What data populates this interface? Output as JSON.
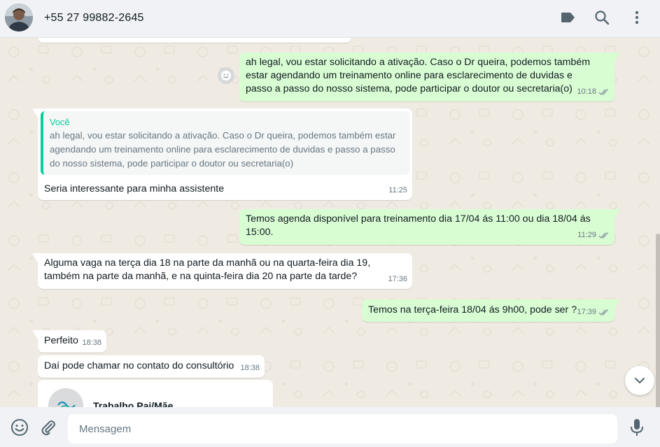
{
  "header": {
    "contact_name": "+55 27 99882-2645"
  },
  "messages": [
    {
      "direction": "out",
      "text": "ah legal, vou estar solicitando a ativação. Caso o Dr queira, podemos também estar agendando um treinamento online para esclarecimento de duvidas e passo a passo do nosso sistema, pode participar o doutor ou secretaria(o)",
      "time": "10:18",
      "status": "read"
    },
    {
      "direction": "in",
      "quote_author": "Você",
      "quote_text": "ah legal, vou estar solicitando a ativação. Caso o Dr queira, podemos também estar agendando um treinamento online para esclarecimento de duvidas e passo a passo do nosso sistema, pode participar o doutor ou secretaria(o)",
      "text": "Seria interessante para minha assistente",
      "time": "11:25"
    },
    {
      "direction": "out",
      "text": "Temos agenda disponível para treinamento dia 17/04 ás 11:00 ou dia 18/04 ás 15:00.",
      "time": "11:29",
      "status": "read"
    },
    {
      "direction": "in",
      "text": "Alguma vaga na terça dia 18 na parte da manhã ou na quarta-feira dia 19, também na parte da manhã, e na quinta-feira dia 20 na parte da tarde?",
      "time": "17:36"
    },
    {
      "direction": "out",
      "text": "Temos na terça-feira 18/04 ás 9h00, pode ser ?",
      "time": "17:39",
      "status": "read"
    },
    {
      "direction": "in",
      "text": "Perfeito",
      "time": "18:38"
    },
    {
      "direction": "in",
      "text": "Daí pode chamar no contato do consultório",
      "time": "18:38"
    },
    {
      "direction": "in",
      "type": "contact-card",
      "title": "Trabalho Pai/Mãe"
    }
  ],
  "composer": {
    "placeholder": "Mensagem"
  },
  "colors": {
    "outgoing_bubble": "#d9fdd3",
    "incoming_bubble": "#ffffff",
    "background": "#efeae2",
    "accent": "#06cf9c",
    "read_ticks": "#53bdeb"
  },
  "icons": {
    "header": [
      "label-icon",
      "search-icon",
      "kebab-menu-icon"
    ],
    "footer": [
      "emoji-icon",
      "attach-icon",
      "microphone-icon"
    ]
  }
}
